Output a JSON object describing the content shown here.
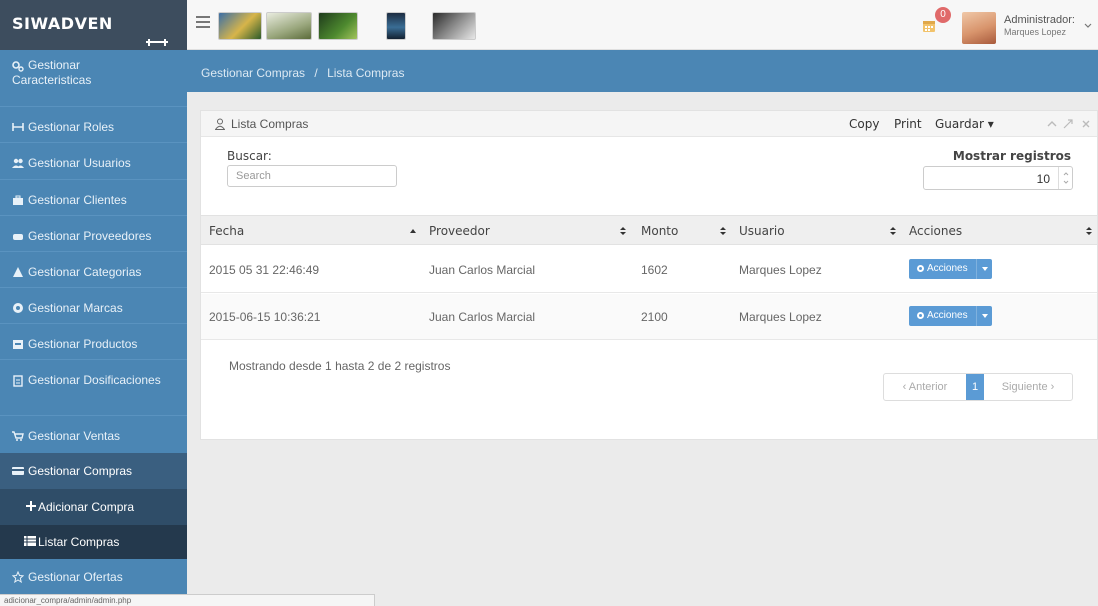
{
  "brand": {
    "name": "SIWADVEN"
  },
  "user": {
    "role": "Administrador:",
    "name": "Marques Lopez",
    "notifications": "0"
  },
  "sidebar": {
    "items": [
      {
        "label": "Gestionar Caracteristicas",
        "icon": "cogs-icon"
      },
      {
        "label": "Gestionar Roles",
        "icon": "sitemap-icon"
      },
      {
        "label": "Gestionar Usuarios",
        "icon": "users-icon"
      },
      {
        "label": "Gestionar Clientes",
        "icon": "briefcase-icon"
      },
      {
        "label": "Gestionar Proveedores",
        "icon": "truck-icon"
      },
      {
        "label": "Gestionar Categorias",
        "icon": "category-icon"
      },
      {
        "label": "Gestionar Marcas",
        "icon": "circle-icon"
      },
      {
        "label": "Gestionar Productos",
        "icon": "box-icon"
      },
      {
        "label": "Gestionar Dosificaciones",
        "icon": "file-icon"
      },
      {
        "label": "Gestionar Ventas",
        "icon": "cart-icon"
      },
      {
        "label": "Gestionar Compras",
        "icon": "credit-card-icon"
      },
      {
        "label": "Gestionar Ofertas",
        "icon": "star-icon"
      }
    ],
    "subitems": [
      {
        "label": "Adicionar Compra"
      },
      {
        "label": "Listar Compras"
      }
    ]
  },
  "breadcrumb": {
    "parent": "Gestionar Compras",
    "separator": "/",
    "current": "Lista Compras"
  },
  "panel": {
    "title": "Lista Compras",
    "tools": {
      "copy": "Copy",
      "print": "Print",
      "save": "Guardar"
    },
    "search": {
      "label": "Buscar:",
      "placeholder": "Search"
    },
    "page_size": {
      "label": "Mostrar registros",
      "value": "10"
    }
  },
  "table": {
    "columns": [
      "Fecha",
      "Proveedor",
      "Monto",
      "Usuario",
      "Acciones"
    ],
    "rows": [
      {
        "fecha": "2015 05 31 22:46:49",
        "proveedor": "Juan Carlos Marcial",
        "monto": "1602",
        "usuario": "Marques Lopez",
        "accion": "Acciones"
      },
      {
        "fecha": "2015-06-15 10:36:21",
        "proveedor": "Juan Carlos Marcial",
        "monto": "2100",
        "usuario": "Marques Lopez",
        "accion": "Acciones"
      }
    ]
  },
  "footer": {
    "info": "Mostrando desde 1 hasta 2 de 2 registros",
    "pagination": {
      "prev": "Anterior",
      "current": "1",
      "next": "Siguiente"
    }
  },
  "statusbar": {
    "text": "adicionar_compra/admin/admin.php"
  },
  "colors": {
    "sidebar": "#4b86b4",
    "brand": "#3d4d5e",
    "accent": "#5b9bd5",
    "badge": "#e06a6a"
  }
}
